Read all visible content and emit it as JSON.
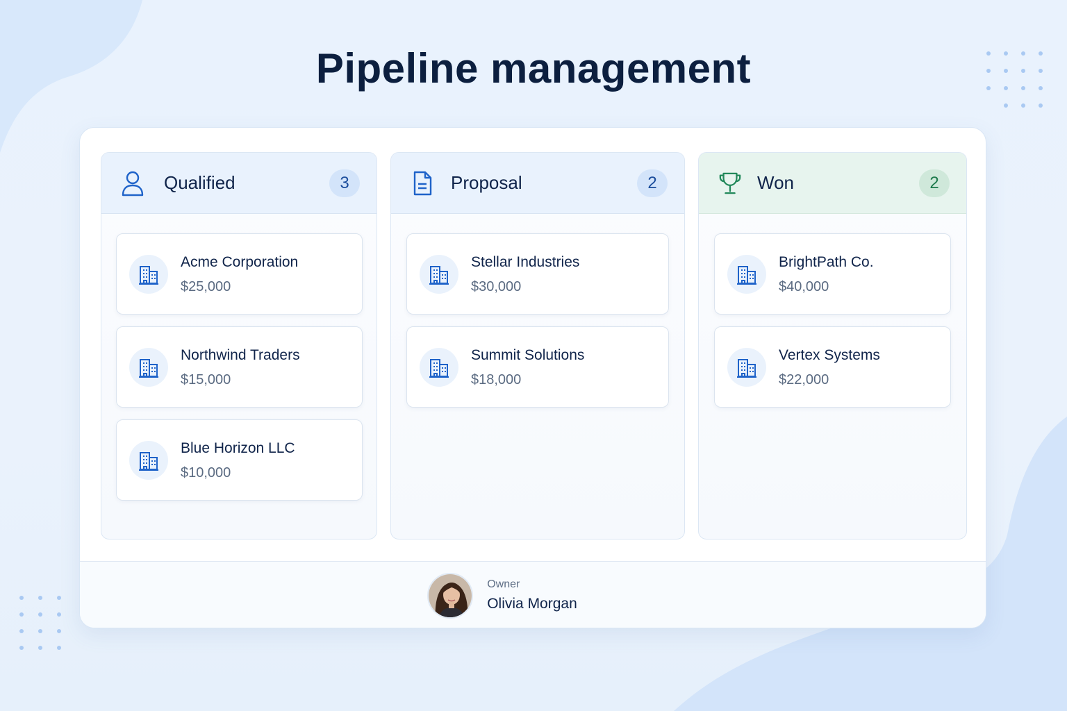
{
  "page": {
    "title": "Pipeline management"
  },
  "colors": {
    "accent_blue": "#1f63c9",
    "won_green": "#22885a",
    "title_navy": "#0c1f3f"
  },
  "columns": [
    {
      "title": "Qualified",
      "count": "3",
      "icon": "user-icon",
      "cards": [
        {
          "name": "Acme Corporation",
          "value": "$25,000",
          "icon": "building-icon"
        },
        {
          "name": "Northwind Traders",
          "value": "$15,000",
          "icon": "building-icon"
        },
        {
          "name": "Blue Horizon LLC",
          "value": "$10,000",
          "icon": "building-icon"
        }
      ]
    },
    {
      "title": "Proposal",
      "count": "2",
      "icon": "document-icon",
      "cards": [
        {
          "name": "Stellar Industries",
          "value": "$30,000",
          "icon": "building-icon"
        },
        {
          "name": "Summit Solutions",
          "value": "$18,000",
          "icon": "building-icon"
        }
      ]
    },
    {
      "title": "Won",
      "count": "2",
      "icon": "trophy-icon",
      "cards": [
        {
          "name": "BrightPath Co.",
          "value": "$40,000",
          "icon": "building-icon"
        },
        {
          "name": "Vertex Systems",
          "value": "$22,000",
          "icon": "building-icon"
        }
      ]
    }
  ],
  "footer": {
    "owner_label": "Owner",
    "owner_name": "Olivia Morgan"
  }
}
